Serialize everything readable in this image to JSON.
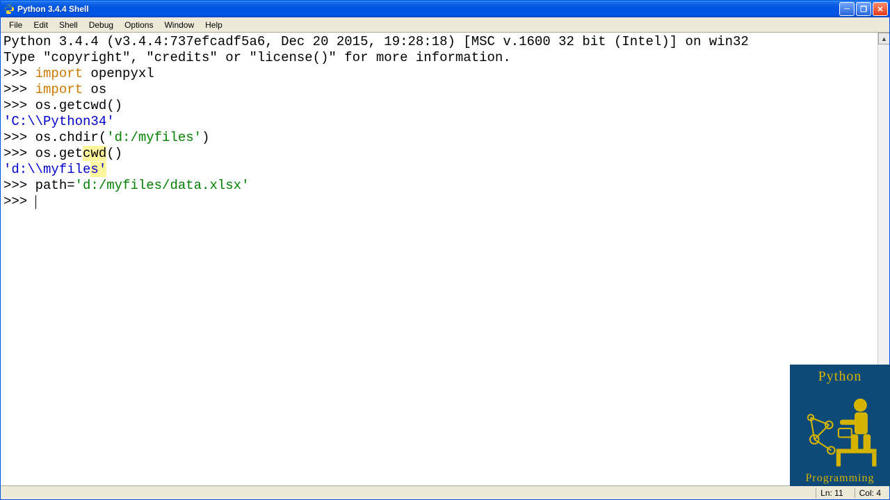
{
  "titlebar": {
    "title": "Python 3.4.4 Shell"
  },
  "menu": {
    "file": "File",
    "edit": "Edit",
    "shell": "Shell",
    "debug": "Debug",
    "options": "Options",
    "window": "Window",
    "help": "Help"
  },
  "banner": {
    "line1": "Python 3.4.4 (v3.4.4:737efcadf5a6, Dec 20 2015, 19:28:18) [MSC v.1600 32 bit (Intel)] on win32",
    "line2": "Type \"copyright\", \"credits\" or \"license()\" for more information."
  },
  "session": {
    "prompt": ">>> ",
    "kw_import": "import",
    "mod_openpyxl": " openpyxl",
    "mod_os": " os",
    "call_getcwd1": "os.getcwd()",
    "out_cwd1": "'C:\\\\Python34'",
    "chdir_pre": "os.chdir(",
    "chdir_str": "'d:/myfiles'",
    "chdir_post": ")",
    "call_getcwd2_pre": "os.get",
    "call_getcwd2_hl": "cwd",
    "call_getcwd2_post": "()",
    "out_cwd2_pre": "'d:\\\\myfile",
    "out_cwd2_hl": "s'",
    "path_pre": "path=",
    "path_str": "'d:/myfiles/data.xlsx'"
  },
  "status": {
    "line": "Ln: 11",
    "col": "Col: 4"
  },
  "watermark": {
    "title": "Python",
    "subtitle": "Programming"
  }
}
